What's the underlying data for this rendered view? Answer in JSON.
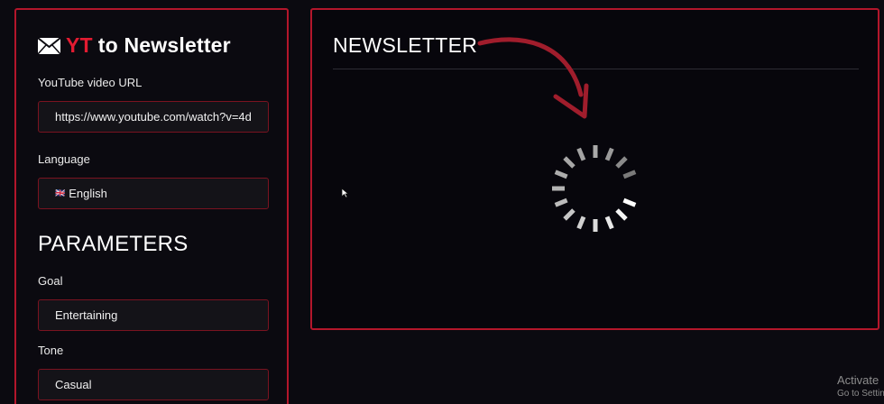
{
  "app": {
    "brand_icon": "envelope-icon",
    "brand_yt": "YT",
    "brand_rest": "to Newsletter"
  },
  "form": {
    "url_label": "YouTube video URL",
    "url_value": "https://www.youtube.com/watch?v=4d",
    "language_label": "Language",
    "language_flag": "🇬🇧",
    "language_value": "English",
    "parameters_title": "PARAMETERS",
    "goal_label": "Goal",
    "goal_value": "Entertaining",
    "tone_label": "Tone",
    "tone_value": "Casual"
  },
  "output": {
    "title": "NEWSLETTER",
    "status_icon": "loading-spinner-icon",
    "annotation_icon": "curved-arrow-icon"
  },
  "watermark": {
    "line1": "Activate",
    "line2": "Go to Settin"
  },
  "colors": {
    "accent": "#b3162b",
    "brand_red": "#e31b31",
    "background": "#0b0a10",
    "field_background": "#141318"
  }
}
